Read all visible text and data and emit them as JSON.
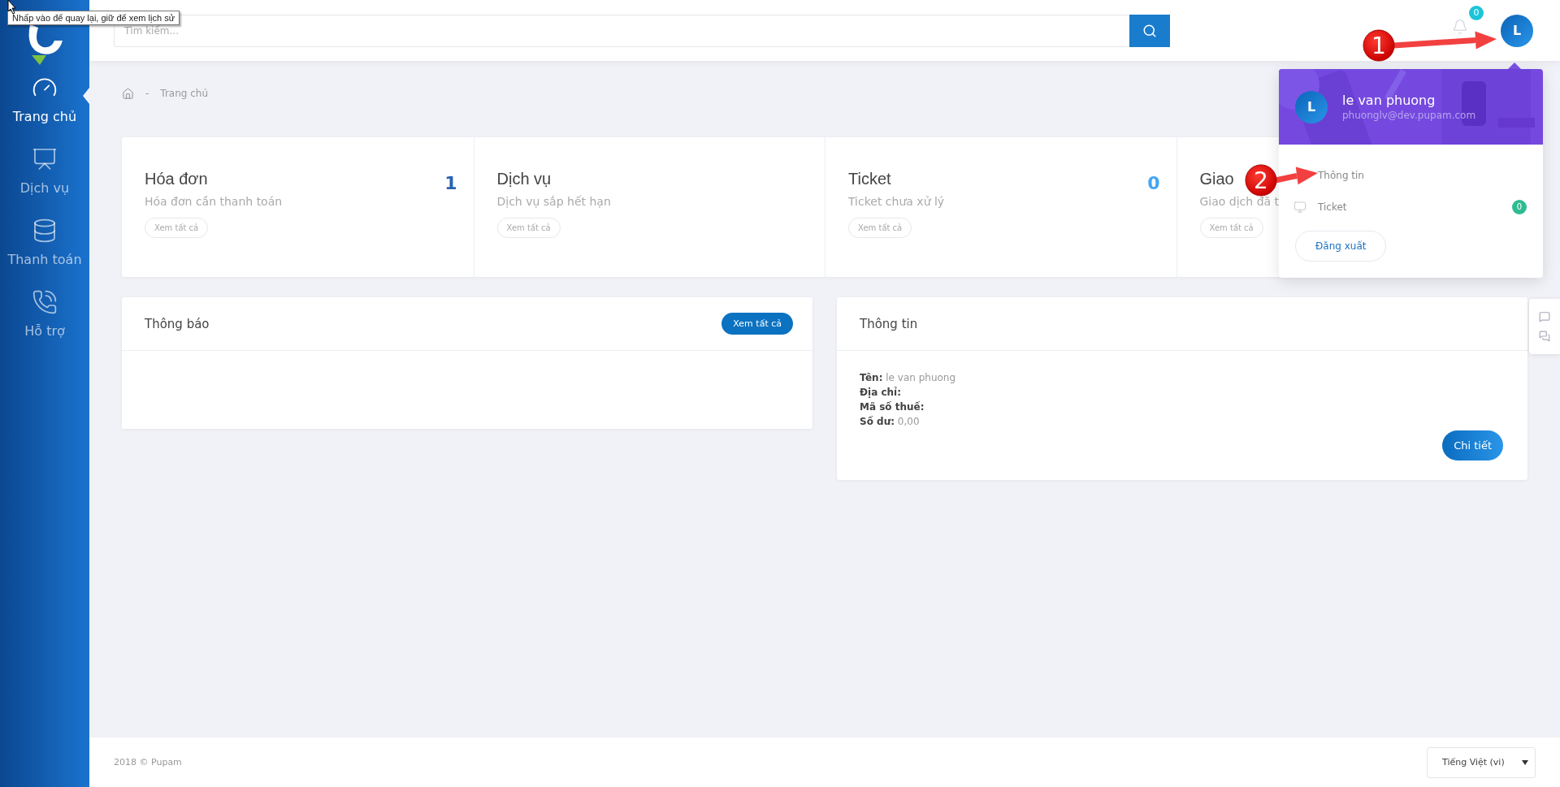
{
  "tooltip": {
    "text": "Nhấp vào để quay lại, giữ để xem lịch sử"
  },
  "sidebar": {
    "items": [
      {
        "label": "Trang chủ",
        "kind": "dashboard",
        "selected": true
      },
      {
        "label": "Dịch vụ",
        "kind": "chart",
        "selected": false
      },
      {
        "label": "Thanh toán",
        "kind": "coins",
        "selected": false
      },
      {
        "label": "Hỗ trợ",
        "kind": "support",
        "selected": false
      }
    ]
  },
  "header": {
    "search": {
      "placeholder": "Tìm kiếm..."
    },
    "notifications": {
      "count": "0"
    },
    "avatar": {
      "initial": "L"
    }
  },
  "breadcrumb": {
    "separator": "-",
    "current": "Trang chủ"
  },
  "stats": [
    {
      "title": "Hóa đơn",
      "subtitle": "Hóa đơn cần thanh toán",
      "value": "1",
      "link": "Xem tất cả",
      "kind": "dark"
    },
    {
      "title": "Dịch vụ",
      "subtitle": "Dịch vụ sắp hết hạn",
      "link": "Xem tất cả"
    },
    {
      "title": "Ticket",
      "subtitle": "Ticket chưa xử lý",
      "value": "0",
      "link": "Xem tất cả",
      "kind": "light"
    },
    {
      "title": "Giao",
      "subtitle": "Giao dịch đã t",
      "link": "Xem tất cả"
    }
  ],
  "notifications_panel": {
    "title": "Thông báo",
    "button": "Xem tất cả"
  },
  "info_panel": {
    "title": "Thông tin",
    "fields": [
      {
        "label": "Tên:",
        "value": "le van phuong"
      },
      {
        "label": "Địa chỉ:"
      },
      {
        "label": "Mã số thuế:"
      },
      {
        "label": "Số dư:",
        "value": "0,00"
      }
    ],
    "button": "Chi tiết"
  },
  "user_menu": {
    "initial": "L",
    "name": "le van phuong",
    "email": "phuonglv@dev.pupam.com",
    "items": [
      {
        "label": "Thông tin",
        "kind": "profile"
      },
      {
        "label": "Ticket",
        "kind": "ticket",
        "badge": "0"
      }
    ],
    "logout": "Đăng xuất"
  },
  "annotations": [
    {
      "number": "1"
    },
    {
      "number": "2"
    }
  ],
  "footer": {
    "copyright": "2018 © Pupam",
    "language": "Tiếng Việt (vi)"
  }
}
